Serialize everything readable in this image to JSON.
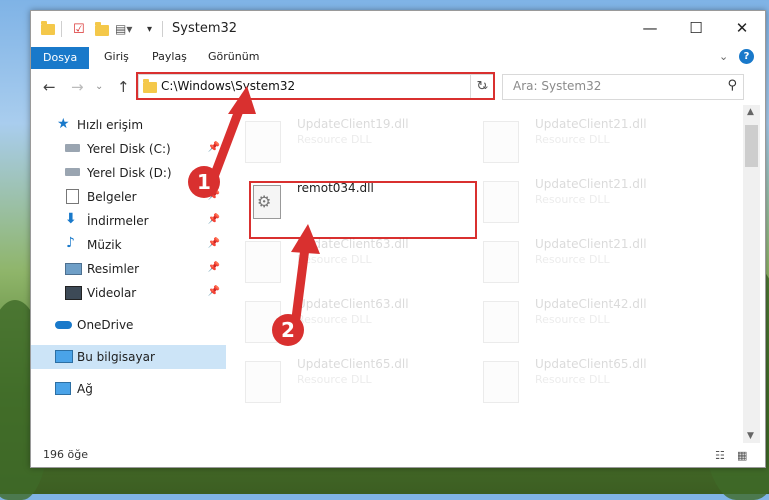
{
  "window": {
    "title": "System32"
  },
  "ribbon": {
    "tabs": [
      "Dosya",
      "Giriş",
      "Paylaş",
      "Görünüm"
    ]
  },
  "address": {
    "path": "C:\\Windows\\System32"
  },
  "search": {
    "placeholder": "Ara: System32"
  },
  "sidebar": {
    "items": [
      {
        "label": "Hızlı erişim"
      },
      {
        "label": "Yerel Disk (C:)"
      },
      {
        "label": "Yerel Disk (D:)"
      },
      {
        "label": "Belgeler"
      },
      {
        "label": "İndirmeler"
      },
      {
        "label": "Müzik"
      },
      {
        "label": "Resimler"
      },
      {
        "label": "Videolar"
      },
      {
        "label": "OneDrive"
      },
      {
        "label": "Bu bilgisayar"
      },
      {
        "label": "Ağ"
      }
    ]
  },
  "files": {
    "highlighted": {
      "name": "remot034.dll"
    },
    "items": [
      {
        "name": "UpdateClient19.dll",
        "type": "Resource DLL"
      },
      {
        "name": "UpdateClient21.dll",
        "type": "Resource DLL"
      },
      {
        "name": "UpdateClient21.dll",
        "type": "Resource DLL"
      },
      {
        "name": "UpdateClient63.dll",
        "type": "Resource DLL"
      },
      {
        "name": "UpdateClient21.dll",
        "type": "Resource DLL"
      },
      {
        "name": "UpdateClient63.dll",
        "type": "Resource DLL"
      },
      {
        "name": "UpdateClient42.dll",
        "type": "Resource DLL"
      },
      {
        "name": "UpdateClient65.dll",
        "type": "Resource DLL"
      },
      {
        "name": "UpdateClient65.dll",
        "type": "Resource DLL"
      }
    ]
  },
  "status": {
    "count": "196 öğe"
  },
  "callouts": [
    "1",
    "2"
  ],
  "colors": {
    "accent": "#1979ca",
    "annotation": "#d9302f",
    "selection": "#cce4f7"
  }
}
